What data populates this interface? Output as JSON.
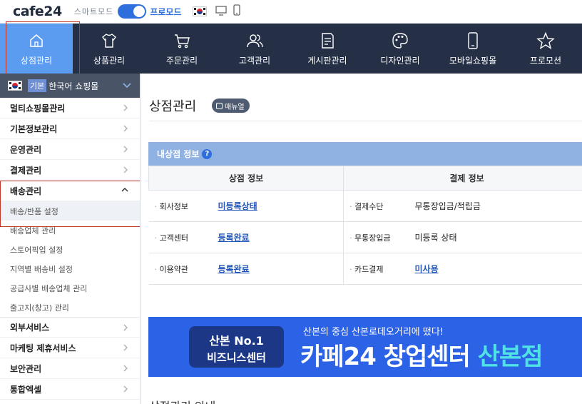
{
  "topbar": {
    "logo_text": "cafe",
    "logo_num": "24",
    "smart_label": "스마트모드",
    "pro_label": "프로모드"
  },
  "nav": {
    "items": [
      {
        "label": "상점관리",
        "icon": "home-icon"
      },
      {
        "label": "상품관리",
        "icon": "shirt-icon"
      },
      {
        "label": "주문관리",
        "icon": "cart-icon"
      },
      {
        "label": "고객관리",
        "icon": "users-icon"
      },
      {
        "label": "게시판관리",
        "icon": "board-icon"
      },
      {
        "label": "디자인관리",
        "icon": "palette-icon"
      },
      {
        "label": "모바일쇼핑몰",
        "icon": "mobile-icon"
      },
      {
        "label": "프로모션",
        "icon": "star-icon"
      }
    ],
    "active_index": 0
  },
  "sidebar": {
    "mall_badge": "기본",
    "mall_name": "한국어 쇼핑몰",
    "items": [
      {
        "label": "멀티쇼핑몰관리"
      },
      {
        "label": "기본정보관리"
      },
      {
        "label": "운영관리"
      },
      {
        "label": "결제관리"
      },
      {
        "label": "배송관리"
      }
    ],
    "sub_items": [
      {
        "label": "배송/반품 설정"
      },
      {
        "label": "배송업체 관리"
      },
      {
        "label": "스토어픽업 설정"
      },
      {
        "label": "지역별 배송비 설정"
      },
      {
        "label": "공급사별 배송업체 관리"
      },
      {
        "label": "출고지(창고) 관리"
      }
    ],
    "items_after": [
      {
        "label": "외부서비스"
      },
      {
        "label": "마케팅 제휴서비스"
      },
      {
        "label": "보안관리"
      },
      {
        "label": "통합엑셀"
      }
    ]
  },
  "content": {
    "page_title": "상점관리",
    "manual_label": "매뉴얼",
    "info_title": "내상점 정보",
    "col_store": "상점 정보",
    "col_pay": "결제 정보",
    "rows": [
      {
        "k1": "회사정보",
        "v1": "미등록상태",
        "k2": "결제수단",
        "v2": "무통장입금/적립금"
      },
      {
        "k1": "고객센터",
        "v1": "등록완료",
        "k2": "무통장입금",
        "v2": "미등록 상태"
      },
      {
        "k1": "이용약관",
        "v1": "등록완료",
        "k2": "카드결제",
        "v2": "미사용"
      }
    ],
    "banner": {
      "pill_line1": "산본 No.1",
      "pill_line2": "비즈니스센터",
      "subtitle": "산본의 중심 산본로데오거리에 떴다!",
      "headline": "카페24 창업센터",
      "headline_highlight": "산본점"
    },
    "next_section_title": "상점관리 안내"
  },
  "colors": {
    "nav_bg": "#253047",
    "nav_active": "#5b9bf0",
    "accent": "#2f6fdd",
    "banner_bg": "#2c63e6"
  }
}
